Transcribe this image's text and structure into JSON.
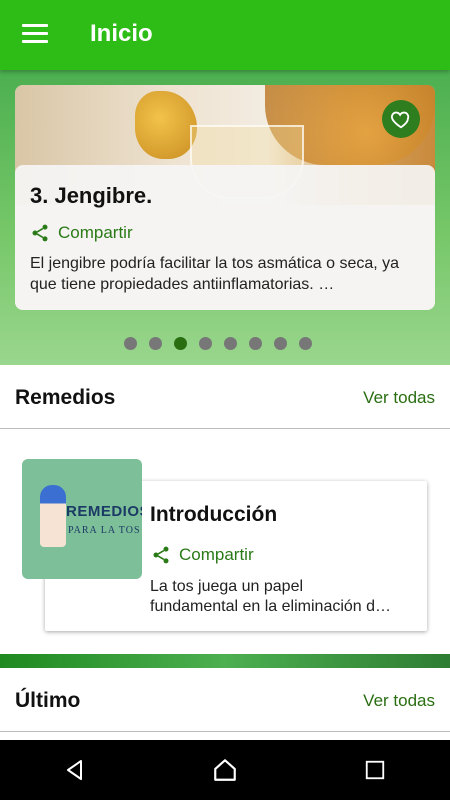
{
  "appbar": {
    "title": "Inicio",
    "menu_icon": "menu-icon"
  },
  "featured": {
    "title": "3. Jengibre.",
    "share_label": "Compartir",
    "description": "El jengibre podría facilitar la tos asmática o seca, ya que tiene propiedades antiinflamatorias. …",
    "favorite_icon": "heart-icon",
    "slides_count": 8,
    "active_slide": 3
  },
  "remedios": {
    "title": "Remedios",
    "link": "Ver todas",
    "items": [
      {
        "thumb_line1": "REMEDIOS",
        "thumb_line2": "PARA LA TOS",
        "title": "Introducción",
        "share_label": "Compartir",
        "desc_line1": "La tos juega un papel",
        "desc_line2": "fundamental en la eliminación d…"
      }
    ]
  },
  "ultimo": {
    "title": "Último",
    "link": "Ver todas"
  },
  "colors": {
    "appbar": "#2dbd16",
    "accent": "#2a6e12",
    "fav": "#2e7d1e"
  },
  "navbar": {
    "back_icon": "back-icon",
    "home_icon": "home-icon",
    "recents_icon": "recents-icon"
  }
}
